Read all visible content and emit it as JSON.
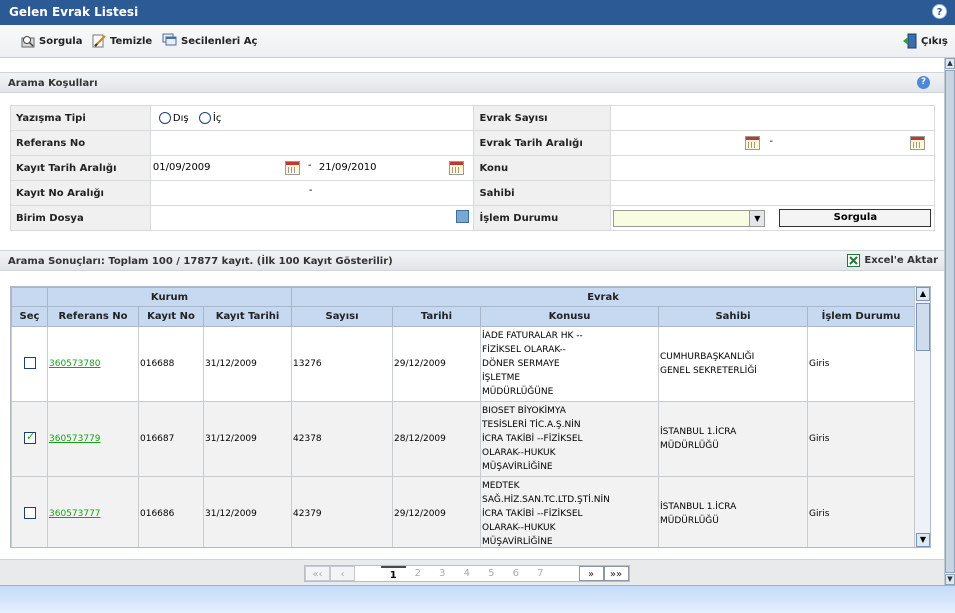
{
  "window": {
    "title": "Gelen Evrak Listesi",
    "help": "?"
  },
  "toolbar": {
    "sorgula": "Sorgula",
    "temizle": "Temizle",
    "secilenleri_ac": "Secilenleri Aç",
    "cikis": "Çıkış"
  },
  "search_section": {
    "title": "Arama Koşulları",
    "help": "?"
  },
  "form": {
    "yazisma_tipi": "Yazışma Tipi",
    "radio_dis": "Dış",
    "radio_ic": "İç",
    "referans_no": "Referans No",
    "kayit_tarih_araligi": "Kayıt Tarih Aralığı",
    "kayit_tarih_baslangic": "01/09/2009",
    "kayit_tarih_bitis": "21/09/2010",
    "kayit_no_araligi": "Kayıt No Aralığı",
    "birim_dosya": "Birim Dosya",
    "evrak_sayisi": "Evrak Sayısı",
    "evrak_tarih_araligi": "Evrak Tarih Aralığı",
    "konu": "Konu",
    "sahibi": "Sahibi",
    "islem_durumu": "İşlem Durumu",
    "dash": "-",
    "sorgula_button": "Sorgula",
    "select_arrow": "▼"
  },
  "results_section": {
    "title": "Arama Sonuçları: Toplam 100 / 17877 kayıt. (İlk 100 Kayıt Gösterilir)",
    "excel": "Excel'e Aktar"
  },
  "grid": {
    "group_kurum": "Kurum",
    "group_evrak": "Evrak",
    "columns": [
      "Seç",
      "Referans No",
      "Kayıt No",
      "Kayıt Tarihi",
      "Sayısı",
      "Tarihi",
      "Konusu",
      "Sahibi",
      "İşlem Durumu"
    ],
    "rows": [
      {
        "checked": false,
        "referans": "360573780",
        "kayit_no": "016688",
        "kayit_tarihi": "31/12/2009",
        "sayisi": "13276",
        "tarihi": "29/12/2009",
        "konu": [
          "İADE FATURALAR HK --",
          "FİZİKSEL OLARAK--",
          "DÖNER SERMAYE",
          "İŞLETME",
          "MÜDÜRLÜĞÜNE"
        ],
        "sahibi": [
          "CUMHURBAŞKANLIĞI",
          "GENEL SEKRETERLİĞİ"
        ],
        "durum": "Giris"
      },
      {
        "checked": true,
        "referans": "360573779",
        "kayit_no": "016687",
        "kayit_tarihi": "31/12/2009",
        "sayisi": "42378",
        "tarihi": "28/12/2009",
        "konu": [
          "BIOSET BİYOKİMYA",
          "TESİSLERİ TİC.A.Ş.NİN",
          "İCRA TAKİBİ --FİZİKSEL",
          "OLARAK--HUKUK",
          "MÜŞAVİRLİĞİNE"
        ],
        "sahibi": [
          "İSTANBUL 1.İCRA",
          "MÜDÜRLÜĞÜ"
        ],
        "durum": "Giris"
      },
      {
        "checked": false,
        "referans": "360573777",
        "kayit_no": "016686",
        "kayit_tarihi": "31/12/2009",
        "sayisi": "42379",
        "tarihi": "29/12/2009",
        "konu": [
          "MEDTEK",
          "SAĞ.HİZ.SAN.TC.LTD.ŞTİ.NİN",
          "İCRA TAKİBİ --FİZİKSEL",
          "OLARAK--HUKUK",
          "MÜŞAVİRLİĞİNE"
        ],
        "sahibi": [
          "İSTANBUL 1.İCRA",
          "MÜDÜRLÜĞÜ"
        ],
        "durum": "Giris"
      }
    ]
  },
  "pager": {
    "first": "«‹",
    "prev": "‹",
    "pages": [
      "1",
      "2",
      "3",
      "4",
      "5",
      "6",
      "7"
    ],
    "current": "1",
    "next": "»",
    "last": "»»"
  }
}
